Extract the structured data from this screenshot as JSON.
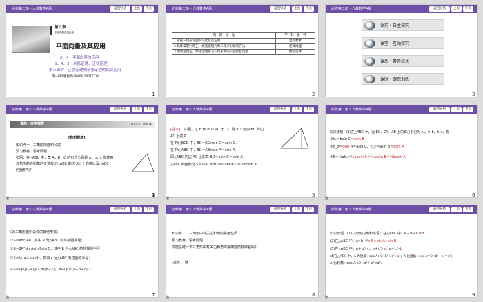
{
  "header": {
    "title": "必修第二册・人教数学A版",
    "nav_label": "返回导航",
    "prev_label": "上页",
    "next_label": "下页"
  },
  "slides": [
    {
      "number": "1",
      "chapter": "第六章",
      "chapter_sub": "平面向量及其应用",
      "main_title": "平面向量及其应用",
      "line1": "6．4　平面向量的应用",
      "line2": "6．4．3　余弦定理、正弦定理",
      "line3": "第三课时　正弦定理和余弦定理的综合应用",
      "credit": "第一PPT模板网-WWW.1PPT.COM"
    },
    {
      "number": "2",
      "col1": "内　容　标　准",
      "col2": "学　科　素　养",
      "rows": [
        [
          "1.掌握三角形的面积公式及其应用.",
          "直观想象"
        ],
        [
          "2.熟练掌握利用正、余弦定理判断三角形形状的方法.",
          "逻辑推理"
        ],
        [
          "3.能够运用正、余弦定理解决三角形中的一些综合问题.",
          "数学运算"
        ]
      ]
    },
    {
      "number": "3",
      "menu": [
        "课前・自主探究",
        "课堂・互动探究",
        "课后・素养培优",
        "课时・跟踪训练"
      ]
    },
    {
      "number": "4",
      "banner": "课前・自主探究",
      "banner_right": "自主学习　基础认知",
      "box": "[教材提炼]",
      "k1": "知识点一　三角形的面积公式",
      "k2": "预习教材，思考问题",
      "p1": "如图，在△ABC 中，角 A，B，C 的对边分别是 a，b，c 你能用",
      "p2": "三角形的边和角的正弦表示△ABC 的边 AC 上的高以及△ABC",
      "p3": "的面积吗？"
    },
    {
      "number": "5",
      "tip": "[提示]",
      "l1": "如图，过 B 作 BD⊥AC 于 D，则 BD 为△ABC 的边",
      "l2": "AC 上的高．",
      "l3": "在 Rt△BCD 中，BD＝BC×sin C＝asin C．",
      "l4": "在 Rt△ABD 中，BD＝AB×sin A＝csin A．",
      "l5": "即△ABC 的边 AC 上的高 BD＝asin C＝csin A．",
      "l6": "△ABC 的面积为 S＝½AC×BD＝½absin C＝½bcsin A．"
    },
    {
      "number": "6",
      "l1": "知识梳理　(1)在△ABC 中，边 BC、CA、AB 上的高分别记为 hₐ，h_b，h_c，则",
      "l2": "①hₐ＝bsin C＝",
      "l2b": "csin B",
      "l3": "②h_b＝",
      "l3b": "csin A",
      "l3c": "＝asin C，h_c＝asin B＝",
      "l3d": "bsin A",
      "l4": "③S＝½ahₐ＝",
      "l4b": "½absin C",
      "l4c": "＝",
      "l4d": "½acsin B",
      "l4e": "＝",
      "l4f": "½bcsin A"
    },
    {
      "number": "7",
      "l0": "(2)三角形面积公式的其他形式：",
      "l1": "①S＝abc/4R，其中 R 为△ABC 的外接圆半径；",
      "l2": "②S＝2R²sin Asin Bsin C，其中 R 为△ABC 的外接圆半径；",
      "l3": "③S＝½(a＋b＋c)r，其中 r 为△ABC 内切圆的半径；",
      "l4": "④S＝√p(p－a)(p－b)(p－c)，其中 p＝(a＋b＋c)/2．"
    },
    {
      "number": "8",
      "l1": "知识点二　三角形中有关边和角的常用性质",
      "l2": "预习教材，思考问题",
      "l3": "你能总结一下三角形中有关边和角的常用性质有哪些吗？",
      "l4": "[提示]　略"
    },
    {
      "number": "9",
      "l1": "知识梳理　(1)三角形内角和定理：在△ABC 中，A＋B＋C＝",
      "l1b": "π",
      "l2": "(2)在△ABC 中，a>b⇔",
      "l2b": "A>B",
      "l2c": "⇔",
      "l2d": "sin A>sin B",
      "l3": "(3)在△ABC 中，a＋b＞",
      "l3b": "c",
      "l3c": "，b＋c＞",
      "l3d": "a",
      "l3e": "，a＋c＞",
      "l3f": "b",
      "l4": "(4)在△ABC 中，A 为锐角⇔cos A>0⇔b²＋c²",
      "l4b": ">",
      "l4c": "a²；A 为直角⇔cos A＝0⇔b²＋c²",
      "l4d": "＝",
      "l4e": "a²；",
      "l5": "A 为钝角⇔cos A<0⇔b²＋c²",
      "l5b": "<",
      "l5c": "a²．"
    }
  ],
  "footer_marks": [
    "治",
    "治",
    "治",
    "治",
    "治",
    "治"
  ]
}
